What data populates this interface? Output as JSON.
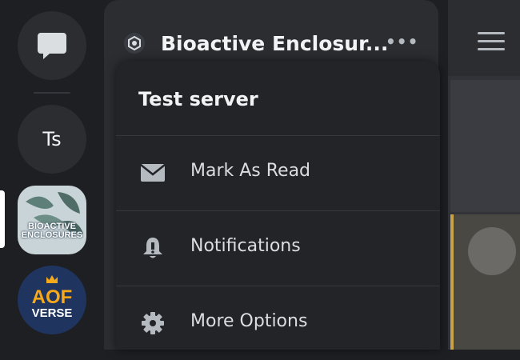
{
  "rail": {
    "dm_icon": "chat-bubble-icon",
    "server_initials": "Ts",
    "servers": [
      {
        "name": "Bioactive Enclosures",
        "icon_text": [
          "BIOACTIVE",
          "ENCLOSURES"
        ],
        "selected": true
      },
      {
        "name": "AOF Verse",
        "icon_text": [
          "AOF",
          "VERSE"
        ]
      }
    ]
  },
  "header": {
    "server_name": "Bioactive Enclosur...",
    "more_icon": "ellipsis-icon"
  },
  "menu": {
    "title": "Test server",
    "items": [
      {
        "label": "Mark As Read",
        "icon": "envelope-icon"
      },
      {
        "label": "Notifications",
        "icon": "bell-icon"
      },
      {
        "label": "More Options",
        "icon": "gear-icon"
      }
    ]
  },
  "colors": {
    "background": "#1e1f22",
    "panel": "#2b2d31",
    "menu": "#232428",
    "text": "#f2f3f5",
    "muted": "#b5bac1"
  }
}
